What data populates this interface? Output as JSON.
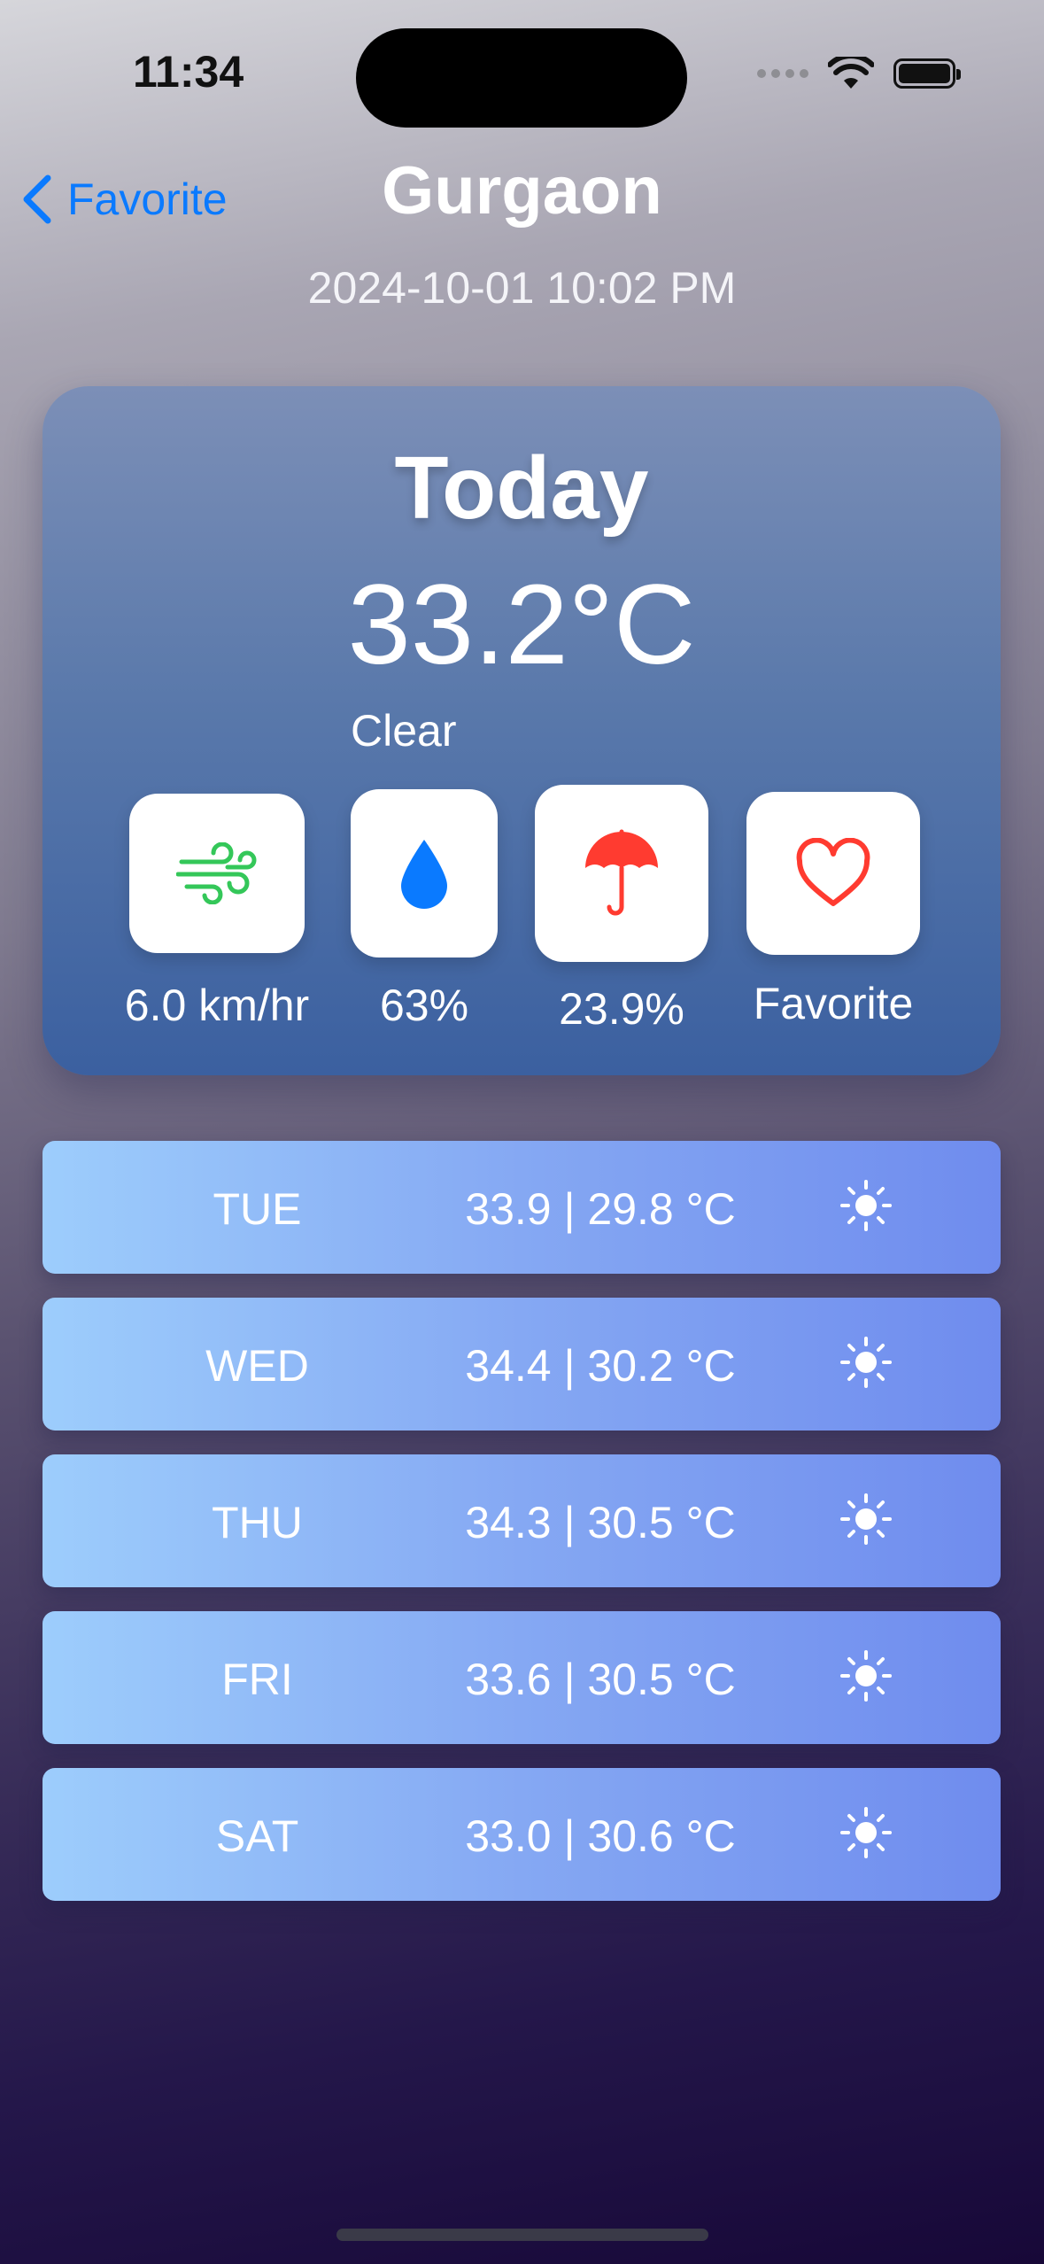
{
  "status_bar": {
    "time": "11:34"
  },
  "nav": {
    "back_label": "Favorite",
    "city": "Gurgaon",
    "datetime": "2024-10-01 10:02 PM"
  },
  "today": {
    "title": "Today",
    "temperature": "33.2°C",
    "condition": "Clear",
    "wind": "6.0 km/hr",
    "humidity": "63%",
    "precipitation": "23.9%",
    "favorite_label": "Favorite"
  },
  "colors": {
    "accent": "#0a7aff",
    "wind_icon": "#34c759",
    "drop_icon": "#0a7aff",
    "umbrella_icon": "#ff3b30",
    "heart_icon": "#ff3b30"
  },
  "forecast": [
    {
      "day": "TUE",
      "range": "33.9 | 29.8 °C",
      "icon": "sun-icon"
    },
    {
      "day": "WED",
      "range": "34.4 | 30.2 °C",
      "icon": "sun-icon"
    },
    {
      "day": "THU",
      "range": "34.3 | 30.5 °C",
      "icon": "sun-icon"
    },
    {
      "day": "FRI",
      "range": "33.6 | 30.5 °C",
      "icon": "sun-icon"
    },
    {
      "day": "SAT",
      "range": "33.0 | 30.6 °C",
      "icon": "sun-icon"
    }
  ]
}
